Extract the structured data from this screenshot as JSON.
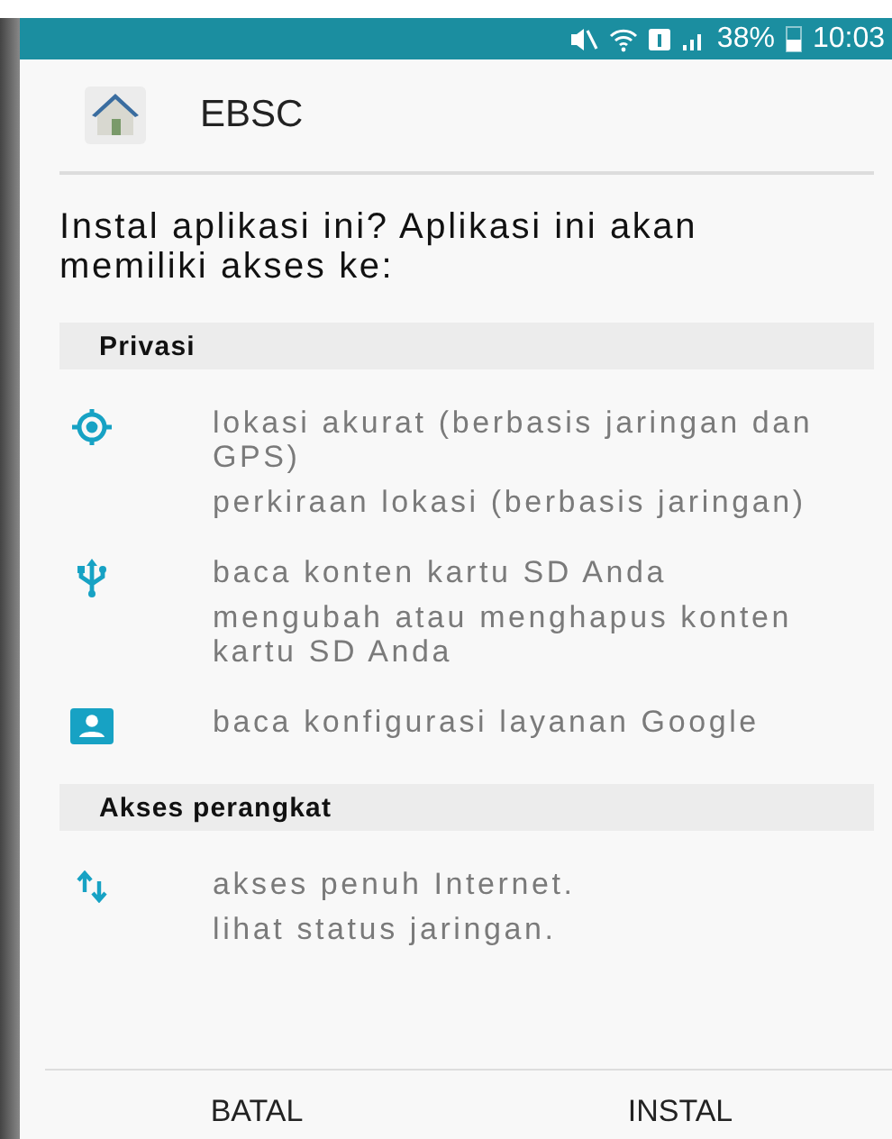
{
  "status_bar": {
    "battery": "38%",
    "time": "10:03"
  },
  "app": {
    "title": "EBSC"
  },
  "prompt": "Instal aplikasi ini? Aplikasi ini akan memiliki akses ke:",
  "sections": [
    {
      "title": "Privasi",
      "groups": [
        {
          "kind": "location",
          "permissions": [
            "lokasi akurat (berbasis jaringan dan GPS)",
            "perkiraan lokasi (berbasis jaringan)"
          ]
        },
        {
          "kind": "usb",
          "permissions": [
            "baca konten kartu SD Anda",
            "mengubah atau menghapus konten kartu SD Anda"
          ]
        },
        {
          "kind": "account",
          "permissions": [
            "baca konfigurasi layanan Google"
          ]
        }
      ]
    },
    {
      "title": "Akses perangkat",
      "groups": [
        {
          "kind": "network",
          "permissions": [
            "akses penuh Internet.",
            "lihat status jaringan."
          ]
        }
      ]
    }
  ],
  "buttons": [
    "BATAL",
    "INSTAL"
  ]
}
